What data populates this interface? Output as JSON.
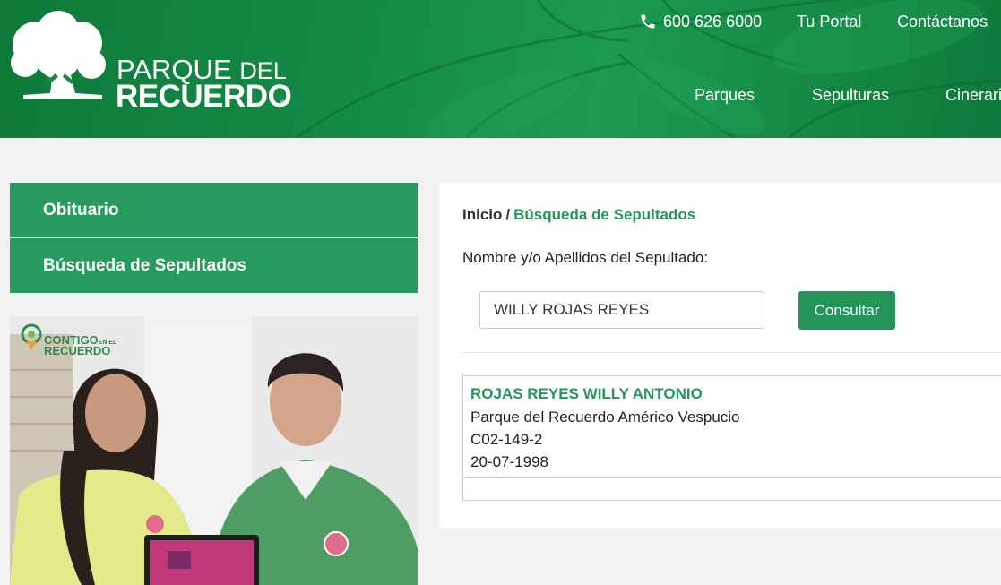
{
  "header": {
    "logo": {
      "line1": "PARQUE",
      "line1_suffix": "DEL",
      "line2": "RECUERDO",
      "registered": "®"
    },
    "top_nav": {
      "phone": "600 626 6000",
      "portal": "Tu Portal",
      "contact": "Contáctanos"
    },
    "main_nav": [
      "Parques",
      "Sepulturas",
      "Cinerarios"
    ]
  },
  "sidebar": {
    "items": [
      {
        "label": "Obituario"
      },
      {
        "label": "Búsqueda de Sepultados"
      }
    ],
    "banner": {
      "logo_line1": "CONTIGO",
      "logo_small": "EN EL",
      "logo_line2": "RECUERDO"
    }
  },
  "main": {
    "breadcrumb": {
      "home": "Inicio",
      "separator": "/",
      "current": "Búsqueda de Sepultados"
    },
    "search": {
      "label": "Nombre y/o Apellidos del Sepultado:",
      "value": "WILLY ROJAS REYES",
      "button": "Consultar"
    },
    "results": [
      {
        "name": "ROJAS REYES WILLY ANTONIO",
        "park": "Parque del Recuerdo Américo Vespucio",
        "location": "C02-149-2",
        "date": "20-07-1998"
      }
    ]
  },
  "colors": {
    "brand_green": "#279a5e",
    "header_green": "#148a45",
    "link_green": "#27955a"
  },
  "icons": {
    "phone": "phone-icon",
    "logo": "tree-icon"
  }
}
